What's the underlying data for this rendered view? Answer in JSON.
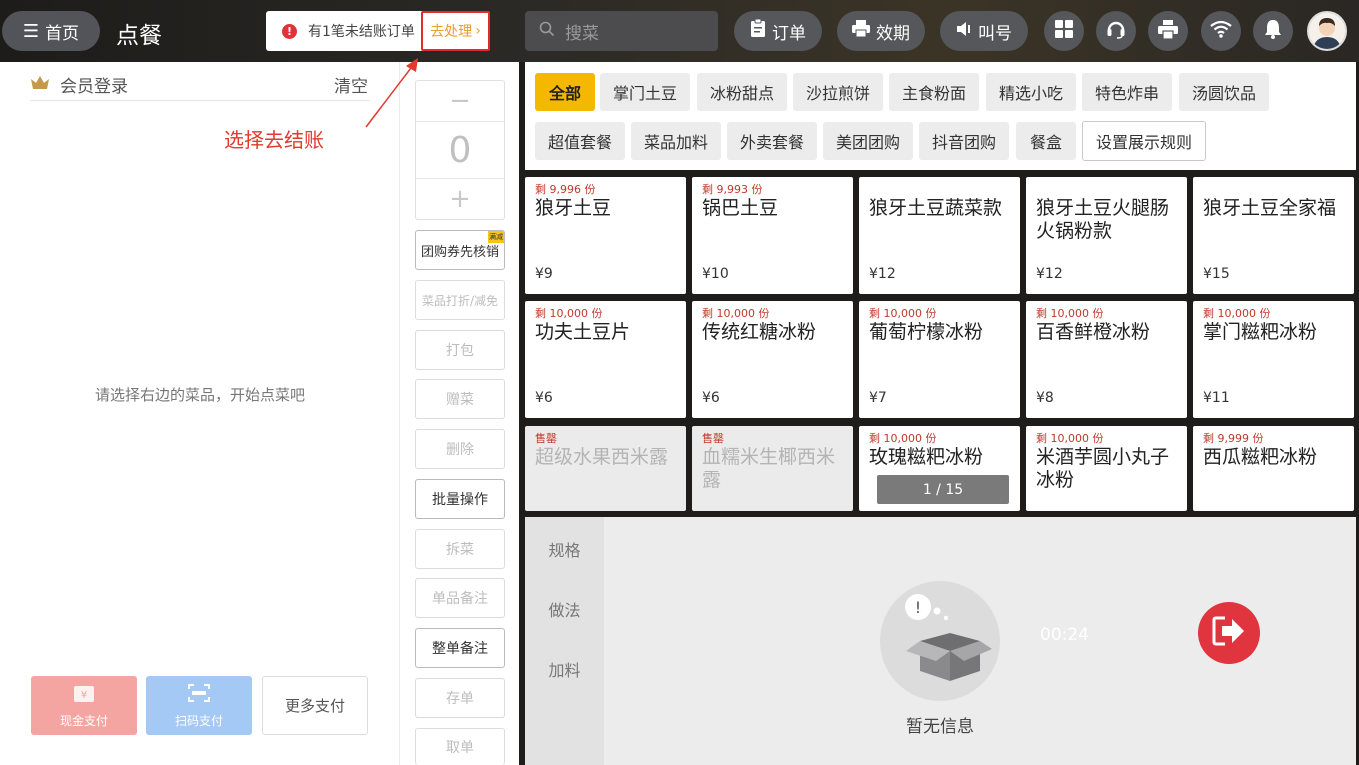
{
  "topbar": {
    "home_label": "首页",
    "page_title": "点餐",
    "alert_text": "有1笔未结账订单",
    "alert_action": "去处理",
    "search_placeholder": "搜菜",
    "buttons": {
      "orders": "订单",
      "expiry": "效期",
      "call": "叫号"
    }
  },
  "left": {
    "member_login": "会员登录",
    "clear": "清空",
    "annotation": "选择去结账",
    "empty_hint": "请选择右边的菜品，开始点菜吧",
    "payments": {
      "cash": "现金支付",
      "scan": "扫码支付",
      "more": "更多支付"
    }
  },
  "qty": {
    "value": "0",
    "minus": "−",
    "plus": "+"
  },
  "ops": {
    "coupon": "团购券先核销",
    "coupon_badge": "满减",
    "discount": "菜品打折/减免",
    "pack": "打包",
    "gift": "赠菜",
    "delete": "删除",
    "batch": "批量操作",
    "split": "拆菜",
    "item_note": "单品备注",
    "order_note": "整单备注",
    "save": "存单",
    "take": "取单"
  },
  "categories": [
    "全部",
    "掌门土豆",
    "冰粉甜点",
    "沙拉煎饼",
    "主食粉面",
    "精选小吃",
    "特色炸串",
    "汤圆饮品",
    "超值套餐",
    "菜品加料",
    "外卖套餐",
    "美团团购",
    "抖音团购",
    "餐盒",
    "设置展示规则"
  ],
  "dishes": [
    {
      "stock": "剩 9,996 份",
      "name": "狼牙土豆",
      "price": "¥9"
    },
    {
      "stock": "剩 9,993 份",
      "name": "锅巴土豆",
      "price": "¥10"
    },
    {
      "stock": "",
      "name": "狼牙土豆蔬菜款",
      "price": "¥12"
    },
    {
      "stock": "",
      "name": "狼牙土豆火腿肠火锅粉款",
      "price": "¥12"
    },
    {
      "stock": "",
      "name": "狼牙土豆全家福",
      "price": "¥15"
    },
    {
      "stock": "剩 10,000 份",
      "name": "功夫土豆片",
      "price": "¥6"
    },
    {
      "stock": "剩 10,000 份",
      "name": "传统红糖冰粉",
      "price": "¥6"
    },
    {
      "stock": "剩 10,000 份",
      "name": "葡萄柠檬冰粉",
      "price": "¥7"
    },
    {
      "stock": "剩 10,000 份",
      "name": "百香鲜橙冰粉",
      "price": "¥8"
    },
    {
      "stock": "剩 10,000 份",
      "name": "掌门糍粑冰粉",
      "price": "¥11"
    },
    {
      "stock": "售罄",
      "name": "超级水果西米露",
      "price": ""
    },
    {
      "stock": "售罄",
      "name": "血糯米生椰西米露",
      "price": ""
    },
    {
      "stock": "剩 10,000 份",
      "name": "玫瑰糍粑冰粉",
      "price": ""
    },
    {
      "stock": "剩 10,000 份",
      "name": "米酒芋圆小丸子冰粉",
      "price": ""
    },
    {
      "stock": "剩 9,999 份",
      "name": "西瓜糍粑冰粉",
      "price": ""
    }
  ],
  "pager": "1 / 15",
  "detail": {
    "tabs": [
      "规格",
      "做法",
      "加料"
    ],
    "empty_text": "暂无信息",
    "timer": "00:24"
  },
  "colors": {
    "accent": "#f5b800",
    "alert_red": "#e32b2b",
    "exit_red": "#e0343f",
    "stock_red": "#c0392b"
  }
}
